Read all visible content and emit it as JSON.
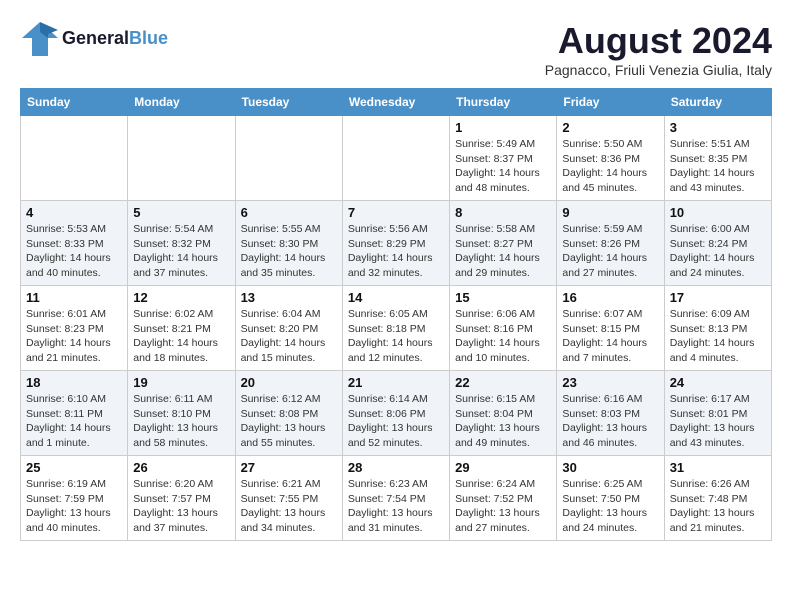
{
  "header": {
    "logo_general": "General",
    "logo_blue": "Blue",
    "month_year": "August 2024",
    "location": "Pagnacco, Friuli Venezia Giulia, Italy"
  },
  "days_of_week": [
    "Sunday",
    "Monday",
    "Tuesday",
    "Wednesday",
    "Thursday",
    "Friday",
    "Saturday"
  ],
  "weeks": [
    [
      {
        "day": "",
        "info": ""
      },
      {
        "day": "",
        "info": ""
      },
      {
        "day": "",
        "info": ""
      },
      {
        "day": "",
        "info": ""
      },
      {
        "day": "1",
        "info": "Sunrise: 5:49 AM\nSunset: 8:37 PM\nDaylight: 14 hours\nand 48 minutes."
      },
      {
        "day": "2",
        "info": "Sunrise: 5:50 AM\nSunset: 8:36 PM\nDaylight: 14 hours\nand 45 minutes."
      },
      {
        "day": "3",
        "info": "Sunrise: 5:51 AM\nSunset: 8:35 PM\nDaylight: 14 hours\nand 43 minutes."
      }
    ],
    [
      {
        "day": "4",
        "info": "Sunrise: 5:53 AM\nSunset: 8:33 PM\nDaylight: 14 hours\nand 40 minutes."
      },
      {
        "day": "5",
        "info": "Sunrise: 5:54 AM\nSunset: 8:32 PM\nDaylight: 14 hours\nand 37 minutes."
      },
      {
        "day": "6",
        "info": "Sunrise: 5:55 AM\nSunset: 8:30 PM\nDaylight: 14 hours\nand 35 minutes."
      },
      {
        "day": "7",
        "info": "Sunrise: 5:56 AM\nSunset: 8:29 PM\nDaylight: 14 hours\nand 32 minutes."
      },
      {
        "day": "8",
        "info": "Sunrise: 5:58 AM\nSunset: 8:27 PM\nDaylight: 14 hours\nand 29 minutes."
      },
      {
        "day": "9",
        "info": "Sunrise: 5:59 AM\nSunset: 8:26 PM\nDaylight: 14 hours\nand 27 minutes."
      },
      {
        "day": "10",
        "info": "Sunrise: 6:00 AM\nSunset: 8:24 PM\nDaylight: 14 hours\nand 24 minutes."
      }
    ],
    [
      {
        "day": "11",
        "info": "Sunrise: 6:01 AM\nSunset: 8:23 PM\nDaylight: 14 hours\nand 21 minutes."
      },
      {
        "day": "12",
        "info": "Sunrise: 6:02 AM\nSunset: 8:21 PM\nDaylight: 14 hours\nand 18 minutes."
      },
      {
        "day": "13",
        "info": "Sunrise: 6:04 AM\nSunset: 8:20 PM\nDaylight: 14 hours\nand 15 minutes."
      },
      {
        "day": "14",
        "info": "Sunrise: 6:05 AM\nSunset: 8:18 PM\nDaylight: 14 hours\nand 12 minutes."
      },
      {
        "day": "15",
        "info": "Sunrise: 6:06 AM\nSunset: 8:16 PM\nDaylight: 14 hours\nand 10 minutes."
      },
      {
        "day": "16",
        "info": "Sunrise: 6:07 AM\nSunset: 8:15 PM\nDaylight: 14 hours\nand 7 minutes."
      },
      {
        "day": "17",
        "info": "Sunrise: 6:09 AM\nSunset: 8:13 PM\nDaylight: 14 hours\nand 4 minutes."
      }
    ],
    [
      {
        "day": "18",
        "info": "Sunrise: 6:10 AM\nSunset: 8:11 PM\nDaylight: 14 hours\nand 1 minute."
      },
      {
        "day": "19",
        "info": "Sunrise: 6:11 AM\nSunset: 8:10 PM\nDaylight: 13 hours\nand 58 minutes."
      },
      {
        "day": "20",
        "info": "Sunrise: 6:12 AM\nSunset: 8:08 PM\nDaylight: 13 hours\nand 55 minutes."
      },
      {
        "day": "21",
        "info": "Sunrise: 6:14 AM\nSunset: 8:06 PM\nDaylight: 13 hours\nand 52 minutes."
      },
      {
        "day": "22",
        "info": "Sunrise: 6:15 AM\nSunset: 8:04 PM\nDaylight: 13 hours\nand 49 minutes."
      },
      {
        "day": "23",
        "info": "Sunrise: 6:16 AM\nSunset: 8:03 PM\nDaylight: 13 hours\nand 46 minutes."
      },
      {
        "day": "24",
        "info": "Sunrise: 6:17 AM\nSunset: 8:01 PM\nDaylight: 13 hours\nand 43 minutes."
      }
    ],
    [
      {
        "day": "25",
        "info": "Sunrise: 6:19 AM\nSunset: 7:59 PM\nDaylight: 13 hours\nand 40 minutes."
      },
      {
        "day": "26",
        "info": "Sunrise: 6:20 AM\nSunset: 7:57 PM\nDaylight: 13 hours\nand 37 minutes."
      },
      {
        "day": "27",
        "info": "Sunrise: 6:21 AM\nSunset: 7:55 PM\nDaylight: 13 hours\nand 34 minutes."
      },
      {
        "day": "28",
        "info": "Sunrise: 6:23 AM\nSunset: 7:54 PM\nDaylight: 13 hours\nand 31 minutes."
      },
      {
        "day": "29",
        "info": "Sunrise: 6:24 AM\nSunset: 7:52 PM\nDaylight: 13 hours\nand 27 minutes."
      },
      {
        "day": "30",
        "info": "Sunrise: 6:25 AM\nSunset: 7:50 PM\nDaylight: 13 hours\nand 24 minutes."
      },
      {
        "day": "31",
        "info": "Sunrise: 6:26 AM\nSunset: 7:48 PM\nDaylight: 13 hours\nand 21 minutes."
      }
    ]
  ]
}
